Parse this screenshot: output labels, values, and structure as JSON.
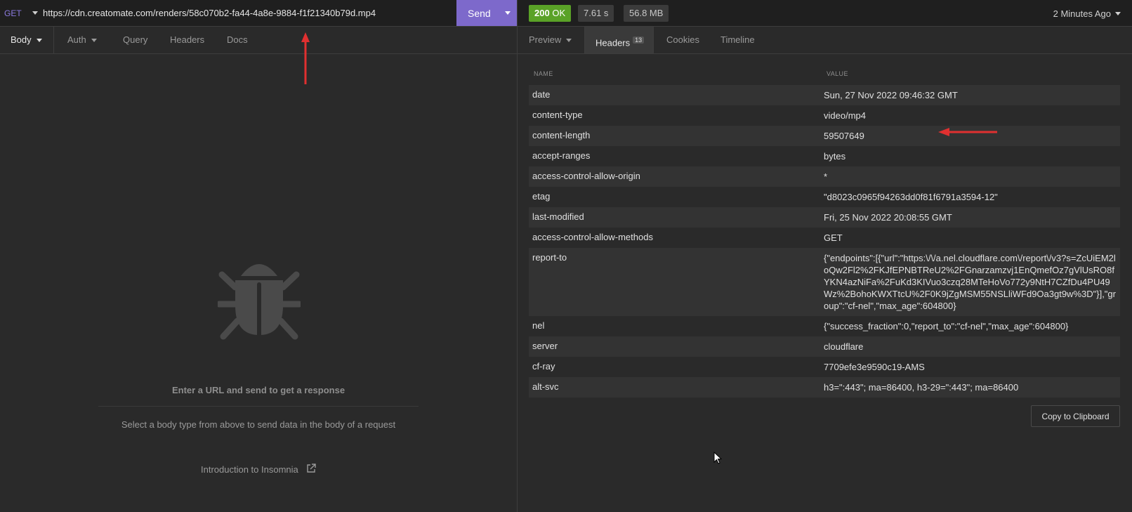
{
  "request": {
    "method": "GET",
    "url": "https://cdn.creatomate.com/renders/58c070b2-fa44-4a8e-9884-f1f21340b79d.mp4",
    "send_label": "Send",
    "tabs": [
      {
        "label": "Body"
      },
      {
        "label": "Auth"
      },
      {
        "label": "Query"
      },
      {
        "label": "Headers"
      },
      {
        "label": "Docs"
      }
    ],
    "empty": {
      "title": "Enter a URL and send to get a response",
      "description": "Select a body type from above to send data in the body of a request",
      "link": "Introduction to Insomnia"
    }
  },
  "response": {
    "status": {
      "code": "200",
      "text": "OK",
      "color": "#5aa227"
    },
    "time": "7.61 s",
    "size": "56.8 MB",
    "ago": "2 Minutes Ago",
    "tabs": [
      {
        "label": "Preview"
      },
      {
        "label": "Headers",
        "badge": "13"
      },
      {
        "label": "Cookies"
      },
      {
        "label": "Timeline"
      }
    ],
    "headers_table": {
      "col_name": "NAME",
      "col_value": "VALUE",
      "rows": [
        {
          "name": "date",
          "value": "Sun, 27 Nov 2022 09:46:32 GMT"
        },
        {
          "name": "content-type",
          "value": "video/mp4"
        },
        {
          "name": "content-length",
          "value": "59507649"
        },
        {
          "name": "accept-ranges",
          "value": "bytes"
        },
        {
          "name": "access-control-allow-origin",
          "value": "*"
        },
        {
          "name": "etag",
          "value": "\"d8023c0965f94263dd0f81f6791a3594-12\""
        },
        {
          "name": "last-modified",
          "value": "Fri, 25 Nov 2022 20:08:55 GMT"
        },
        {
          "name": "access-control-allow-methods",
          "value": "GET"
        },
        {
          "name": "report-to",
          "value": "{\"endpoints\":[{\"url\":\"https:\\/\\/a.nel.cloudflare.com\\/report\\/v3?s=ZcUiEM2loQw2Fl2%2FKJfEPNBTReU2%2FGnarzamzvj1EnQmefOz7gVlUsRO8fYKN4azNiFa%2FuKd3KIVuo3czq28MTeHoVo772y9NtH7CZfDu4PU49Wz%2BohoKWXTtcU%2F0K9jZgMSM55NSLliWFd9Oa3gt9w%3D\"}],\"group\":\"cf-nel\",\"max_age\":604800}"
        },
        {
          "name": "nel",
          "value": "{\"success_fraction\":0,\"report_to\":\"cf-nel\",\"max_age\":604800}"
        },
        {
          "name": "server",
          "value": "cloudflare"
        },
        {
          "name": "cf-ray",
          "value": "7709efe3e9590c19-AMS"
        },
        {
          "name": "alt-svc",
          "value": "h3=\":443\"; ma=86400, h3-29=\":443\"; ma=86400"
        }
      ]
    },
    "copy_label": "Copy to Clipboard"
  },
  "accent_color": "#7d69cb",
  "annotation_color": "#e03030"
}
